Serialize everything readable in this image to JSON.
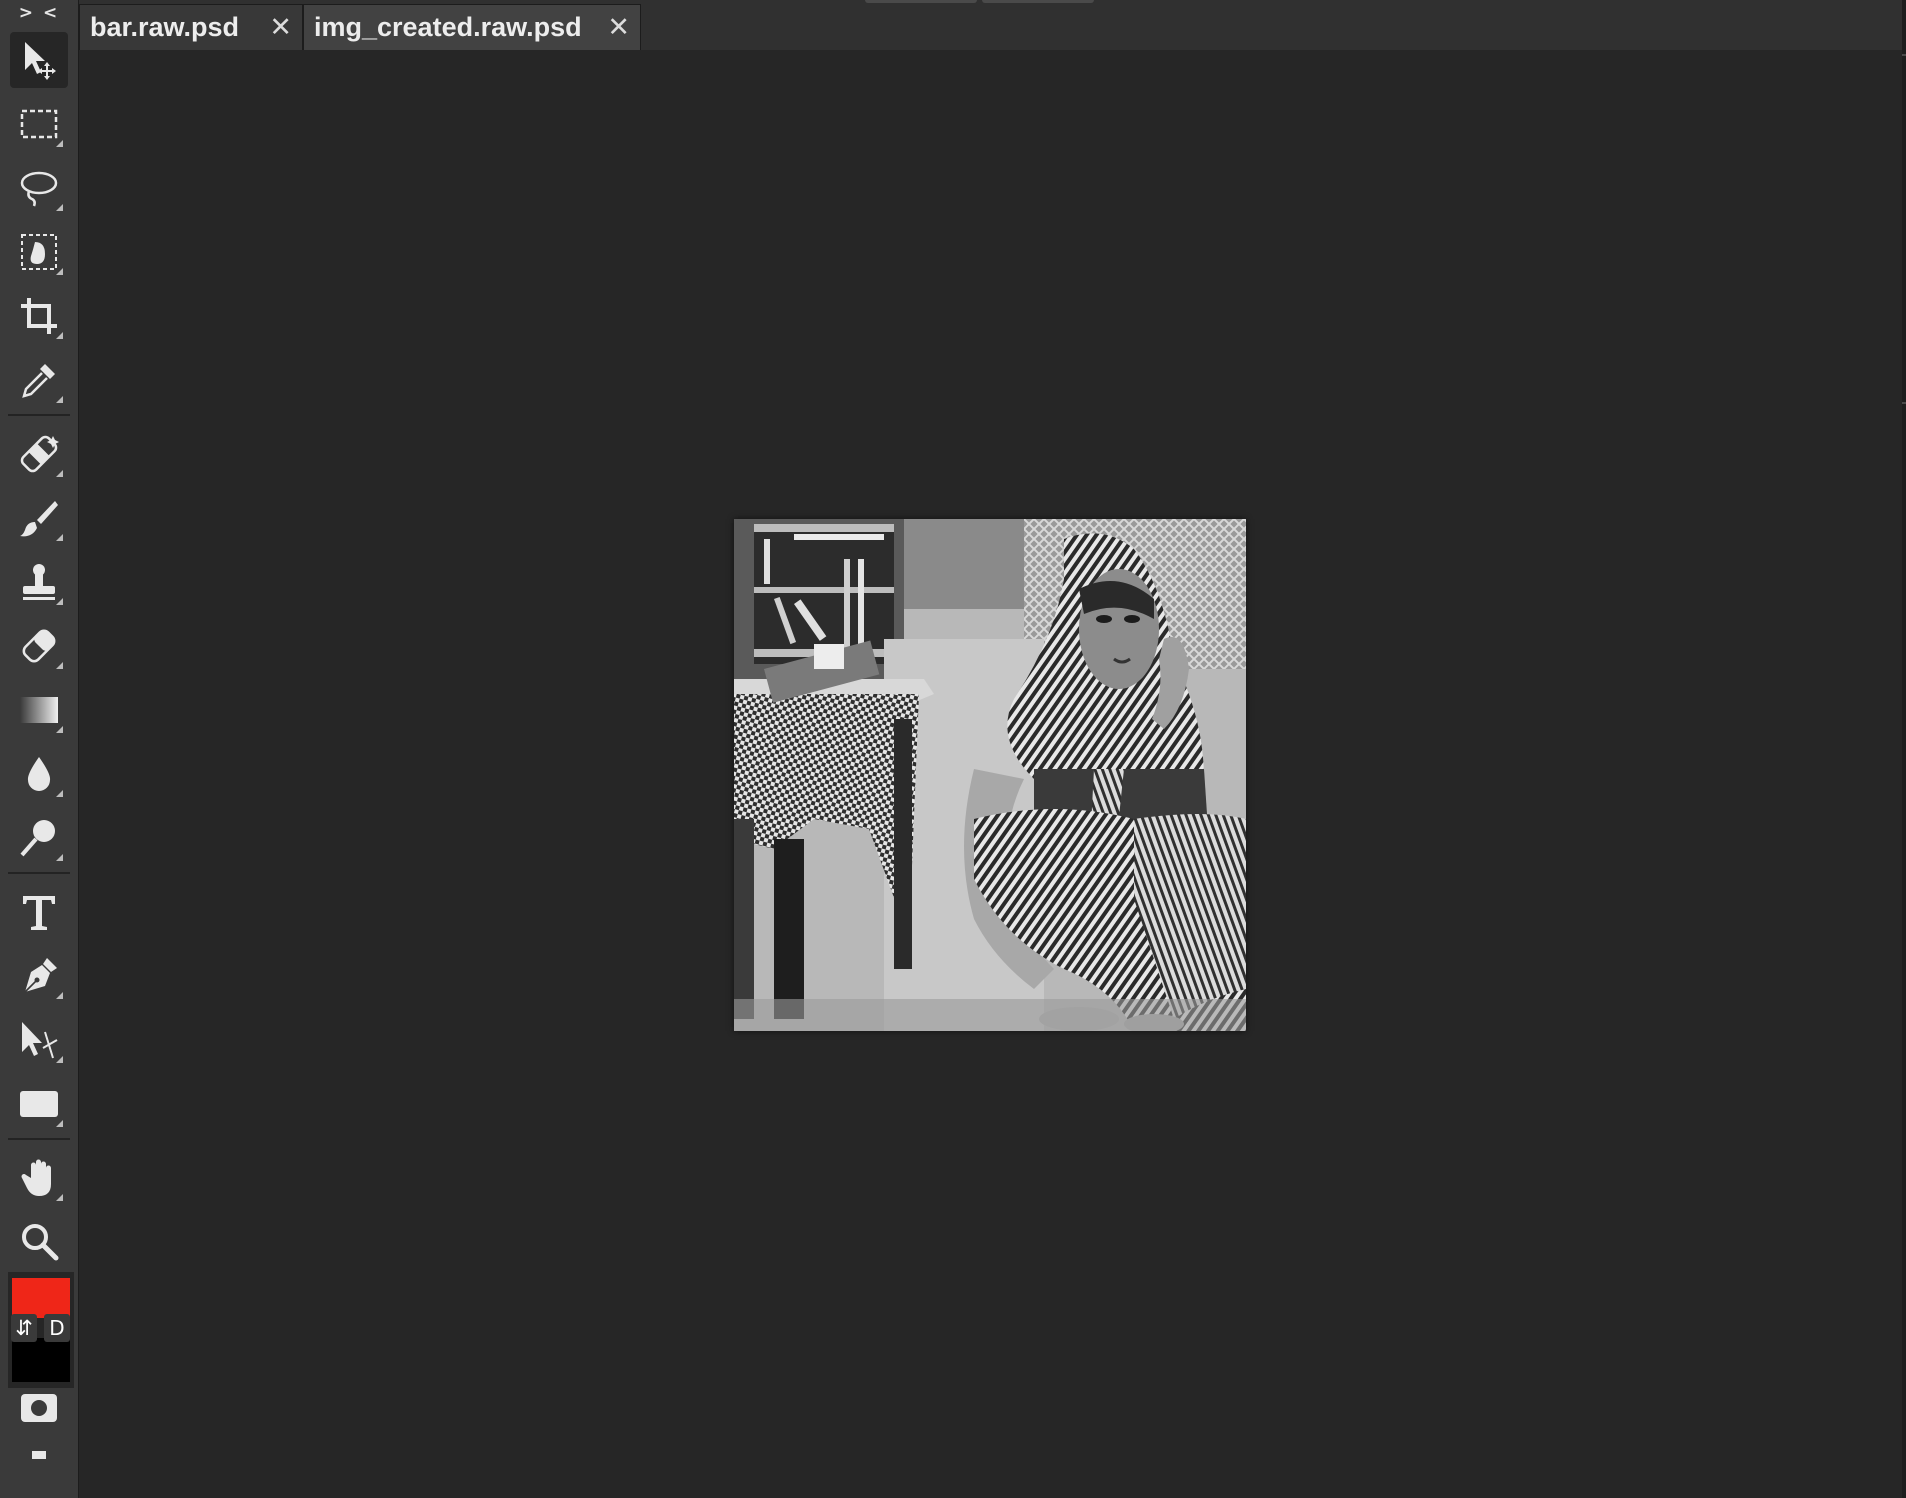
{
  "toolbar": {
    "collapse_glyph": "> <",
    "tools": [
      {
        "name": "move-tool",
        "icon": "move-icon",
        "active": true
      },
      {
        "name": "rectangular-marquee-tool",
        "icon": "marquee-icon",
        "active": false
      },
      {
        "name": "lasso-tool",
        "icon": "lasso-icon",
        "active": false
      },
      {
        "name": "quick-selection-tool",
        "icon": "quick-select-icon",
        "active": false
      },
      {
        "name": "crop-tool",
        "icon": "crop-icon",
        "active": false
      },
      {
        "name": "eyedropper-tool",
        "icon": "eyedropper-icon",
        "active": false
      },
      {
        "name": "healing-brush-tool",
        "icon": "bandage-icon",
        "active": false
      },
      {
        "name": "brush-tool",
        "icon": "brush-icon",
        "active": false
      },
      {
        "name": "clone-stamp-tool",
        "icon": "stamp-icon",
        "active": false
      },
      {
        "name": "eraser-tool",
        "icon": "eraser-icon",
        "active": false
      },
      {
        "name": "gradient-tool",
        "icon": "gradient-icon",
        "active": false
      },
      {
        "name": "blur-tool",
        "icon": "drop-icon",
        "active": false
      },
      {
        "name": "dodge-tool",
        "icon": "dodge-icon",
        "active": false
      },
      {
        "name": "type-tool",
        "icon": "type-icon",
        "active": false
      },
      {
        "name": "pen-tool",
        "icon": "pen-icon",
        "active": false
      },
      {
        "name": "path-selection-tool",
        "icon": "path-select-icon",
        "active": false
      },
      {
        "name": "shape-tool",
        "icon": "rectangle-shape-icon",
        "active": false
      },
      {
        "name": "hand-tool",
        "icon": "hand-icon",
        "active": false
      },
      {
        "name": "zoom-tool",
        "icon": "zoom-icon",
        "active": false
      }
    ],
    "colors": {
      "foreground": "#ef2618",
      "background": "#000000",
      "swap_glyph": "⇵",
      "default_label": "D"
    },
    "quick_mask_icon": "quick-mask-icon",
    "screen_mode_icon": "screen-mode-icon"
  },
  "tabs": [
    {
      "label": "bar.raw.psd",
      "close": "✕",
      "active": false
    },
    {
      "label": "img_created.raw.psd",
      "close": "✕",
      "active": true
    }
  ],
  "canvas": {
    "document": "img_created.raw.psd",
    "image_description_icon": "grayscale-photo"
  },
  "theme": {
    "workspace_bg": "#262626",
    "toolbar_bg": "#3a3a3a",
    "accent_fg": "#ef2618"
  }
}
